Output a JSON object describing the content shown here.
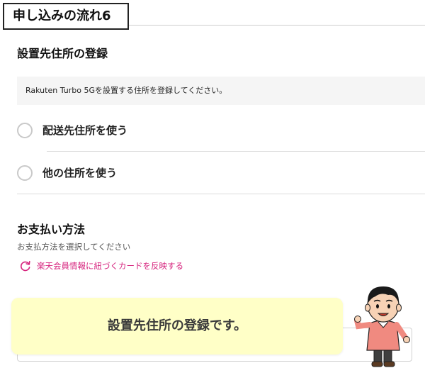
{
  "step_badge": "申し込みの流れ6",
  "address_section": {
    "title": "設置先住所の登録",
    "info": "Rakuten Turbo 5Gを設置する住所を登録してください。",
    "options": [
      {
        "label": "配送先住所を使う",
        "selected": false
      },
      {
        "label": "他の住所を使う",
        "selected": false
      }
    ]
  },
  "payment_section": {
    "title": "お支払い方法",
    "helper": "お支払方法を選択してください",
    "reflect_link": "楽天会員情報に紐づくカードを反映する"
  },
  "caption": "設置先住所の登録です。",
  "colors": {
    "link": "#d6247e",
    "caption_bg": "#ffffc7"
  },
  "icons": [
    "refresh-icon",
    "presenter-illustration"
  ]
}
